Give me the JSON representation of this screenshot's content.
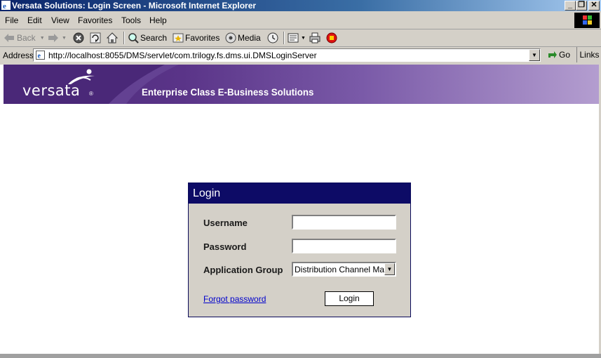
{
  "window": {
    "title": "Versata Solutions: Login Screen - Microsoft Internet Explorer",
    "minimize_glyph": "_",
    "restore_glyph": "❐",
    "close_glyph": "✕"
  },
  "menu": {
    "items": [
      {
        "label": "File"
      },
      {
        "label": "Edit"
      },
      {
        "label": "View"
      },
      {
        "label": "Favorites"
      },
      {
        "label": "Tools"
      },
      {
        "label": "Help"
      }
    ]
  },
  "toolbar": {
    "back_label": "Back",
    "search_label": "Search",
    "favorites_label": "Favorites",
    "media_label": "Media"
  },
  "address": {
    "label": "Address",
    "url": "http://localhost:8055/DMS/servlet/com.trilogy.fs.dms.ui.DMSLoginServer",
    "go_label": "Go",
    "links_label": "Links"
  },
  "banner": {
    "brand": "versata",
    "tagline": "Enterprise Class E-Business Solutions"
  },
  "login": {
    "title": "Login",
    "username_label": "Username",
    "username_value": "",
    "password_label": "Password",
    "password_value": "",
    "group_label": "Application Group",
    "group_selected": "Distribution Channel Management",
    "forgot_label": "Forgot password",
    "submit_label": "Login"
  },
  "colors": {
    "panel_header": "#0d0b66",
    "banner_start": "#4b2a7a",
    "link": "#0000cc"
  }
}
